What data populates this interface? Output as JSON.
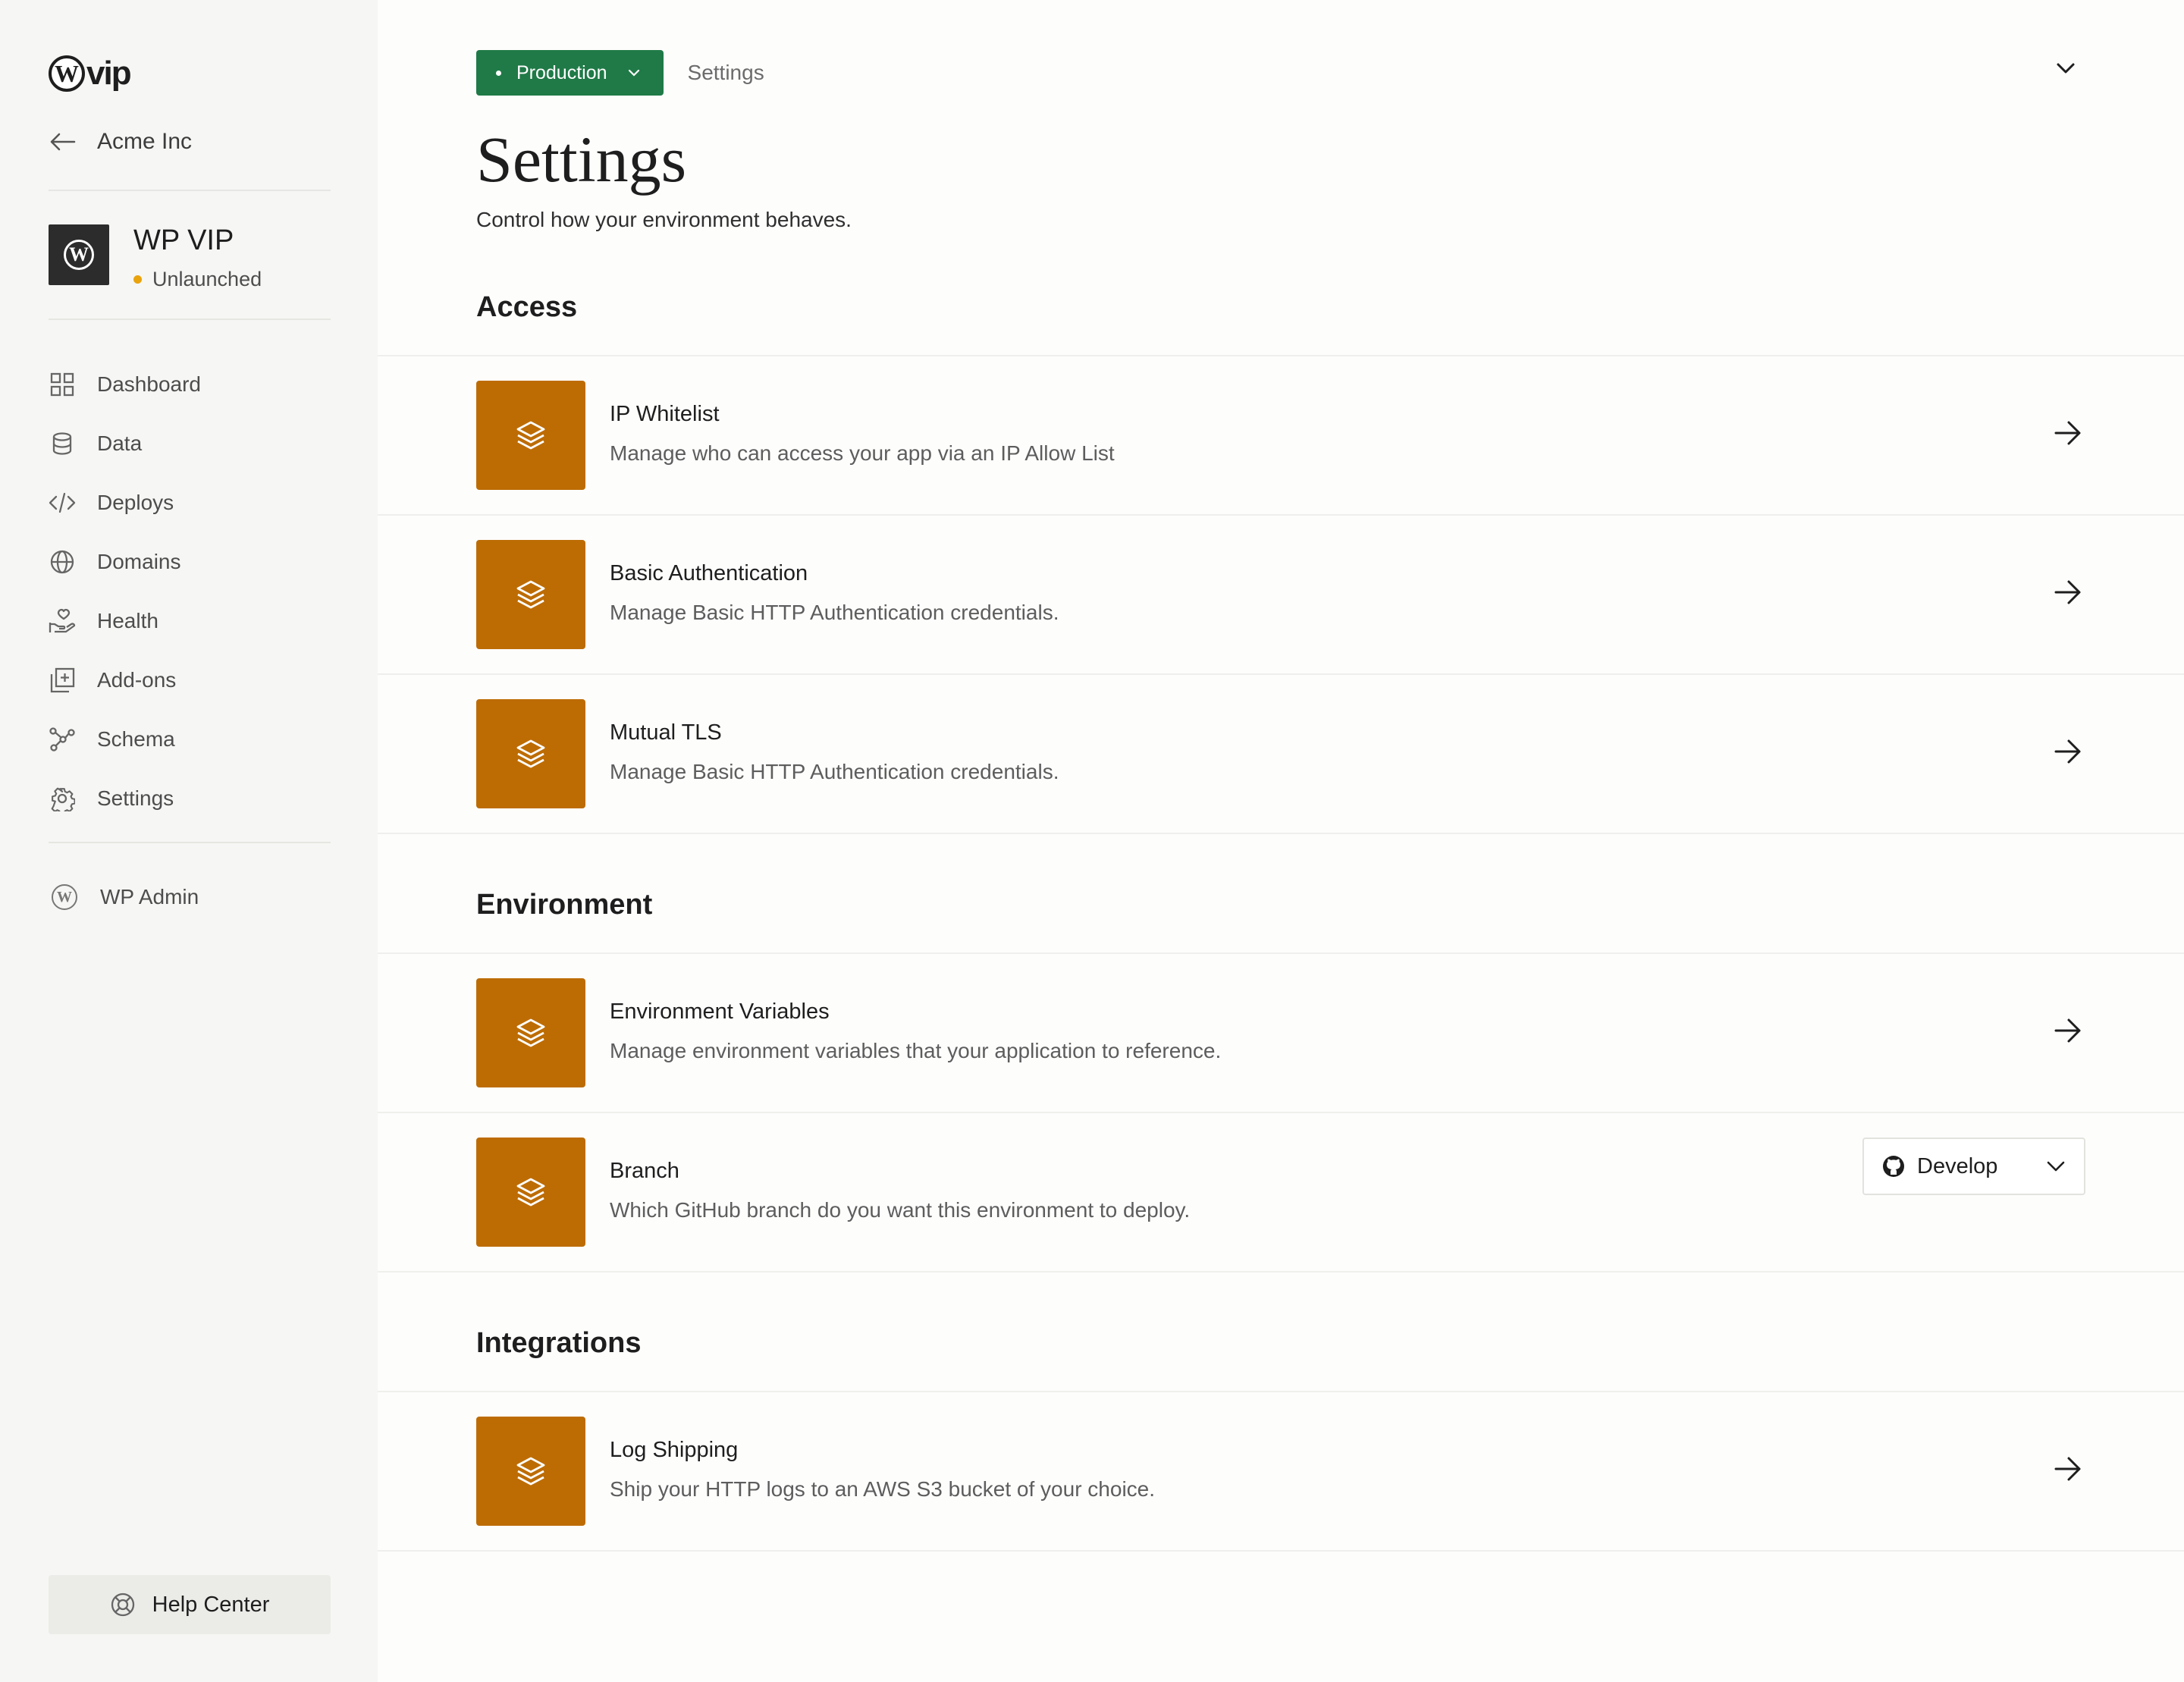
{
  "sidebar": {
    "logo_text": "vip",
    "logo_mark": "W",
    "back_label": "Acme Inc",
    "site": {
      "name": "WP VIP",
      "status": "Unlaunched",
      "status_color": "#e9a30c"
    },
    "nav": [
      {
        "label": "Dashboard",
        "icon": "grid-icon"
      },
      {
        "label": "Data",
        "icon": "database-icon"
      },
      {
        "label": "Deploys",
        "icon": "code-icon"
      },
      {
        "label": "Domains",
        "icon": "globe-icon"
      },
      {
        "label": "Health",
        "icon": "heart-hand-icon"
      },
      {
        "label": "Add-ons",
        "icon": "add-square-icon"
      },
      {
        "label": "Schema",
        "icon": "network-icon"
      },
      {
        "label": "Settings",
        "icon": "gear-icon"
      }
    ],
    "wp_admin_label": "WP Admin",
    "help_label": "Help Center"
  },
  "header": {
    "environment": "Production",
    "environment_color": "#1f7a47",
    "breadcrumb": "Settings"
  },
  "page": {
    "title": "Settings",
    "subtitle": "Control how your environment behaves."
  },
  "sections": {
    "access": {
      "title": "Access",
      "items": [
        {
          "title": "IP Whitelist",
          "desc": "Manage who can access your app via an IP Allow List"
        },
        {
          "title": "Basic Authentication",
          "desc": "Manage Basic HTTP Authentication credentials."
        },
        {
          "title": "Mutual TLS",
          "desc": "Manage Basic HTTP Authentication credentials."
        }
      ]
    },
    "environment": {
      "title": "Environment",
      "items": [
        {
          "title": "Environment Variables",
          "desc": "Manage environment variables that your application to reference."
        },
        {
          "title": "Branch",
          "desc": "Which GitHub branch do you want this environment to deploy.",
          "select_value": "Develop"
        }
      ]
    },
    "integrations": {
      "title": "Integrations",
      "items": [
        {
          "title": "Log Shipping",
          "desc": "Ship your HTTP logs to an AWS S3 bucket of your choice."
        }
      ]
    }
  },
  "colors": {
    "accent_tile": "#bd6c04"
  }
}
